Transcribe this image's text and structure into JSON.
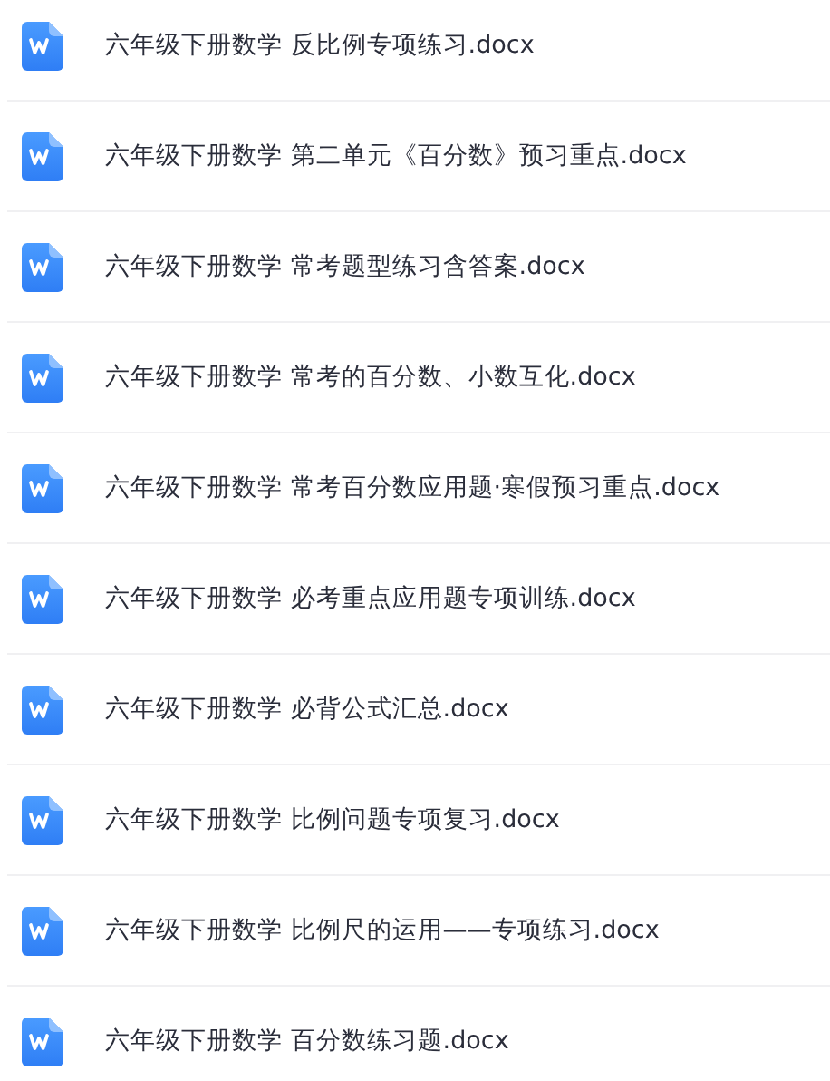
{
  "files": [
    {
      "name": "六年级下册数学 反比例专项练习.docx"
    },
    {
      "name": "六年级下册数学 第二单元《百分数》预习重点.docx"
    },
    {
      "name": "六年级下册数学 常考题型练习含答案.docx"
    },
    {
      "name": "六年级下册数学 常考的百分数、小数互化.docx"
    },
    {
      "name": "六年级下册数学 常考百分数应用题·寒假预习重点.docx"
    },
    {
      "name": "六年级下册数学 必考重点应用题专项训练.docx"
    },
    {
      "name": "六年级下册数学 必背公式汇总.docx"
    },
    {
      "name": "六年级下册数学 比例问题专项复习.docx"
    },
    {
      "name": "六年级下册数学 比例尺的运用——专项练习.docx"
    },
    {
      "name": "六年级下册数学 百分数练习题.docx"
    }
  ]
}
